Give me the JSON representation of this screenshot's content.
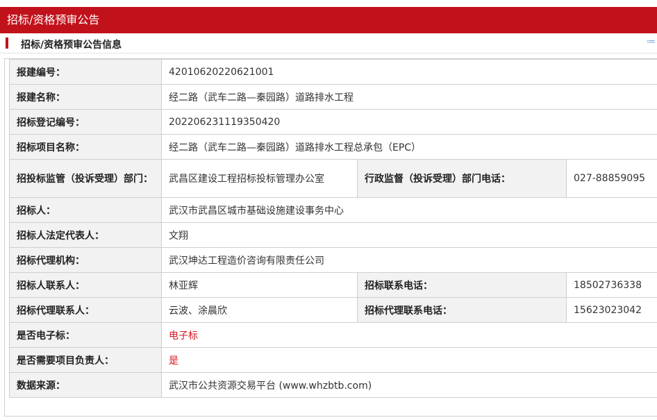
{
  "header": {
    "title": "招标/资格预审公告"
  },
  "section": {
    "title": "招标/资格预审公告信息",
    "collapse_icon": "double-chevron-up-icon"
  },
  "fields": {
    "project_code": {
      "label": "报建编号：",
      "value": "42010620220621001"
    },
    "project_name": {
      "label": "报建名称：",
      "value": "经二路（武车二路—秦园路）道路排水工程"
    },
    "tender_reg_no": {
      "label": "招标登记编号：",
      "value": "202206231119350420"
    },
    "tender_project_name": {
      "label": "招标项目名称：",
      "value": "经二路（武车二路—秦园路）道路排水工程总承包（EPC）"
    },
    "supervisor_dept": {
      "label": "招投标监管（投诉受理）部门：",
      "value": "武昌区建设工程招标投标管理办公室"
    },
    "admin_phone": {
      "label": "行政监督（投诉受理）部门电话：",
      "value": "027-88859095"
    },
    "tenderer": {
      "label": "招标人：",
      "value": "武汉市武昌区城市基础设施建设事务中心"
    },
    "legal_rep": {
      "label": "招标人法定代表人：",
      "value": "文翔"
    },
    "agency": {
      "label": "招标代理机构：",
      "value": "武汉坤达工程造价咨询有限责任公司"
    },
    "tenderer_contact": {
      "label": "招标人联系人：",
      "value": "林亚辉"
    },
    "tender_phone": {
      "label": "招标联系电话：",
      "value": "18502736338"
    },
    "agency_contact": {
      "label": "招标代理联系人：",
      "value": "云波、涂晨欣"
    },
    "agency_phone": {
      "label": "招标代理联系电话：",
      "value": "15623023042"
    },
    "electronic": {
      "label": "是否电子标：",
      "value": "电子标"
    },
    "need_manager": {
      "label": "是否需要项目负责人：",
      "value": "是"
    },
    "source": {
      "label": "数据来源：",
      "value": "武汉市公共资源交易平台 (www.whzbtb.com)"
    }
  },
  "colors": {
    "brand": "#c1121b",
    "highlight_text": "#d6151f",
    "label_bg": "#f2f2f2",
    "border": "#cfcfcf"
  }
}
